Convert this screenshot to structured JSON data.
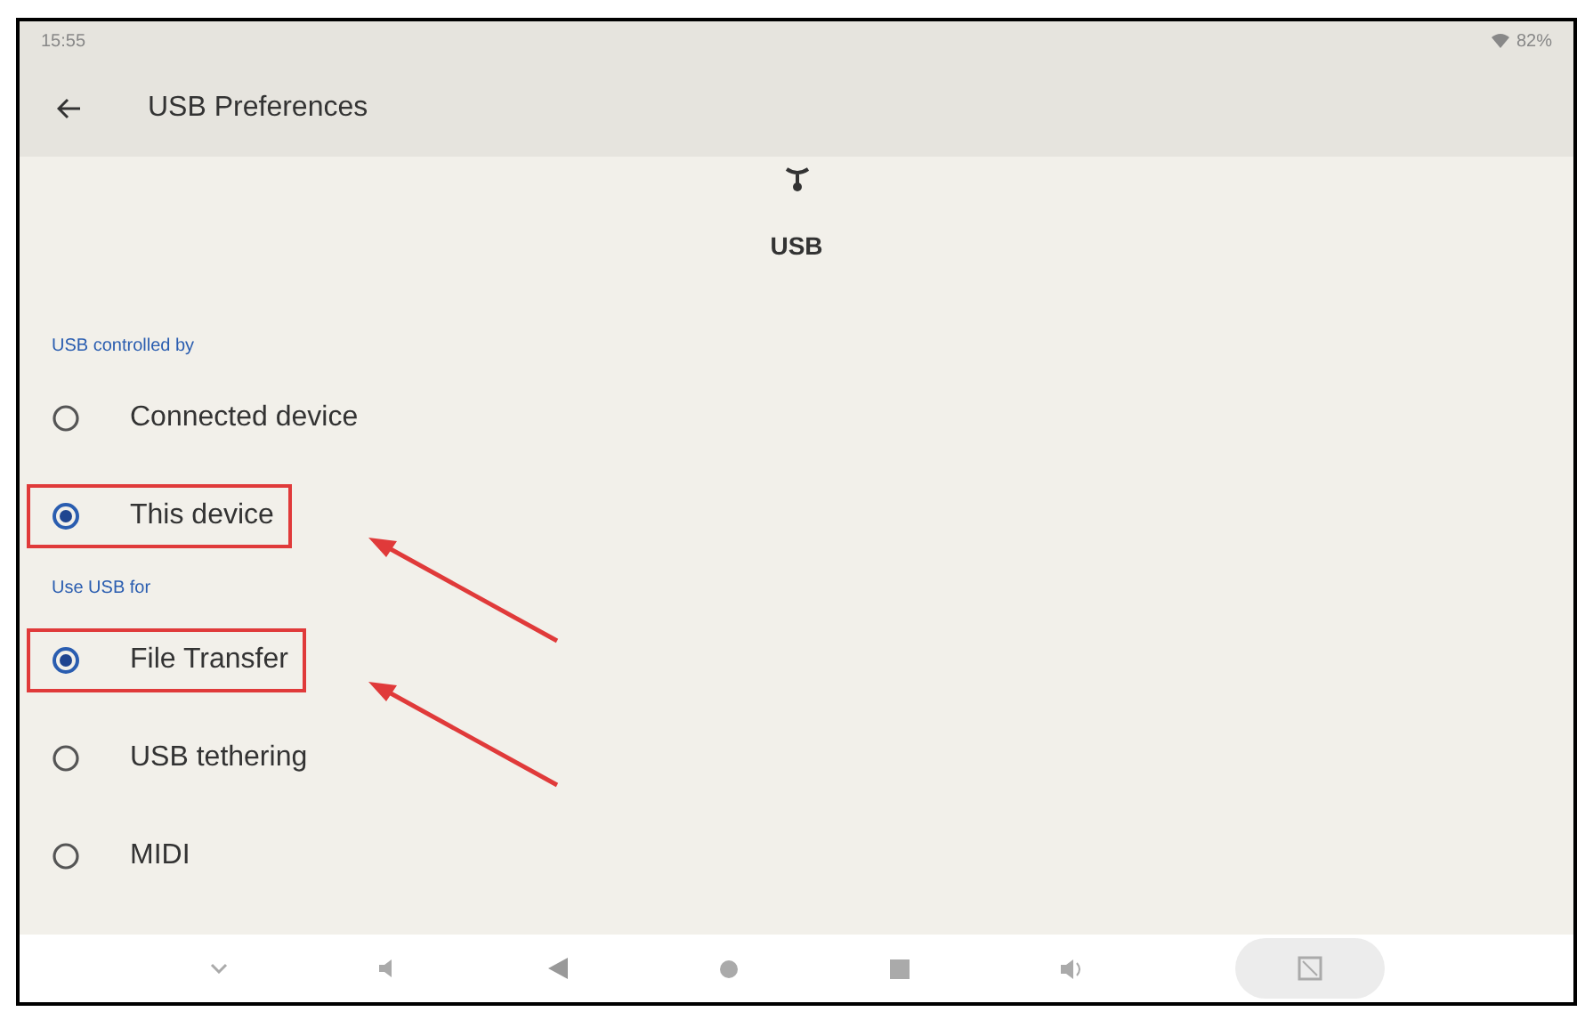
{
  "status_bar": {
    "time": "15:55",
    "battery": "82%"
  },
  "app_bar": {
    "title": "USB Preferences"
  },
  "header": {
    "label": "USB"
  },
  "sections": [
    {
      "title": "USB controlled by",
      "options": [
        {
          "label": "Connected device",
          "selected": false,
          "highlighted": false
        },
        {
          "label": "This device",
          "selected": true,
          "highlighted": true
        }
      ]
    },
    {
      "title": "Use USB for",
      "options": [
        {
          "label": "File Transfer",
          "selected": true,
          "highlighted": true
        },
        {
          "label": "USB tethering",
          "selected": false,
          "highlighted": false
        },
        {
          "label": "MIDI",
          "selected": false,
          "highlighted": false
        }
      ]
    }
  ]
}
